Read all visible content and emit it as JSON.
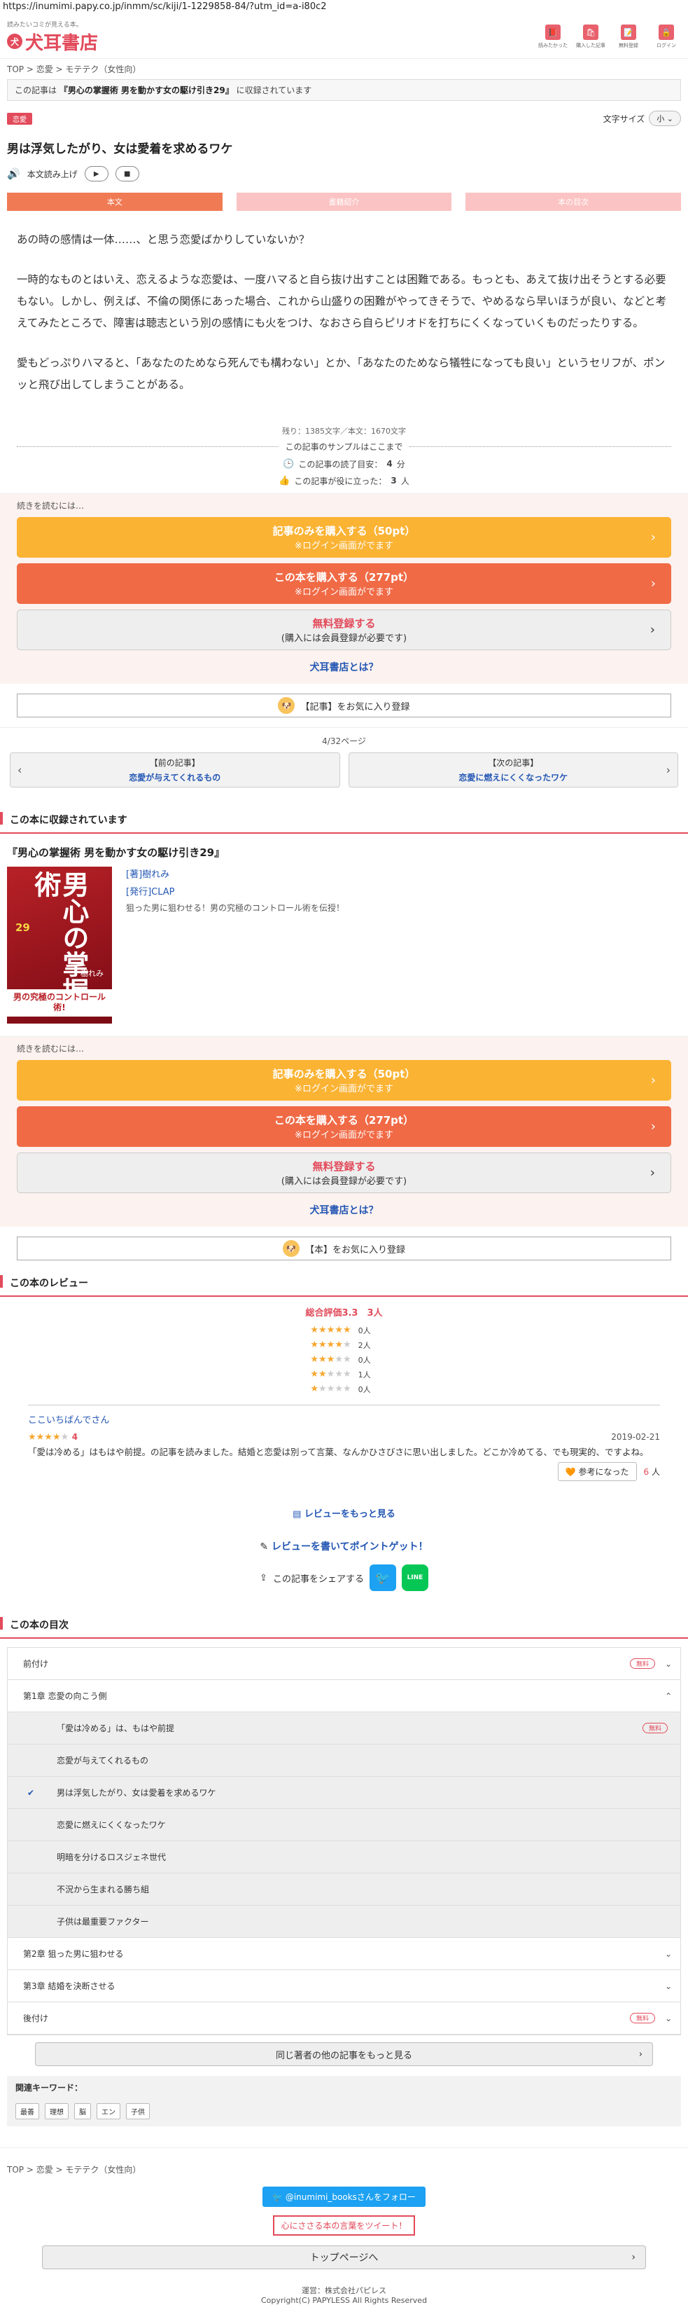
{
  "url": "https://inumimi.papy.co.jp/inmm/sc/kiji/1-1229858-84/?utm_id=a-i80c2",
  "header": {
    "tagline": "読みたいコミが見える本。",
    "logo_text": "犬耳書店",
    "icons": [
      {
        "label": "読みたかった",
        "name": "bookmark-icon",
        "glyph": "📕"
      },
      {
        "label": "購入した記事",
        "name": "purchased-icon",
        "glyph": "🛍"
      },
      {
        "label": "無料登録",
        "name": "register-icon",
        "glyph": "📝"
      },
      {
        "label": "ログイン",
        "name": "login-icon",
        "glyph": "🔒"
      }
    ]
  },
  "breadcrumb": [
    "TOP",
    "恋愛",
    "モテテク（女性向）"
  ],
  "collected_note": {
    "prefix": "この記事は",
    "book": "『男心の掌握術 男を動かす女の駆け引き29』",
    "suffix": "に収録されています"
  },
  "category_badge": "恋愛",
  "font_size": {
    "label": "文字サイズ",
    "value": "小"
  },
  "title": "男は浮気したがり、女は愛着を求めるワケ",
  "tts": {
    "label": "本文読み上げ",
    "play": "▶",
    "stop": "■"
  },
  "tabs": [
    {
      "label": "本文",
      "active": true
    },
    {
      "label": "書籍紹介",
      "active": false
    },
    {
      "label": "本の目次",
      "active": false
    }
  ],
  "article": {
    "paragraphs": [
      "あの時の感情は一体……、と思う恋愛ばかりしていないか？",
      "一時的なものとはいえ、恋えるような恋愛は、一度ハマると自ら抜け出すことは困難である。もっとも、あえて抜け出そうとする必要もない。しかし、例えば、不倫の関係にあった場合、これから山盛りの困難がやってきそうで、やめるなら早いほうが良い、などと考えてみたところで、障害は聴志という別の感情にも火をつけ、なおさら自らピリオドを打ちにくくなっていくものだったりする。",
      "愛もどっぷりハマると、「あなたのためなら死んでも構わない」とか、「あなたのためなら犠牲になっても良い」というセリフが、ポンッと飛び出してしまうことがある。"
    ],
    "counts": "残り：1385文字／本文：1670文字",
    "sample_end": "この記事のサンプルはここまで",
    "read_time_prefix": "この記事の読了目安：",
    "read_time": "4",
    "read_time_unit": "分",
    "helpful_prefix": "この記事が役に立った：",
    "helpful": "3",
    "helpful_unit": "人"
  },
  "buy_box": {
    "lead": "続きを読むには…",
    "article_buy": {
      "l1": "記事のみを購入する（50pt）",
      "l2": "※ログイン画面がでます"
    },
    "book_buy": {
      "l1": "この本を購入する（277pt）",
      "l2": "※ログイン画面がでます"
    },
    "register": {
      "l1": "無料登録する",
      "l2": "(購入には会員登録が必要です)"
    },
    "whatis": "犬耳書店とは？",
    "arrow": "›"
  },
  "fav_article": "【記事】をお気に入り登録",
  "page_num": "4/32ページ",
  "prev": {
    "label": "【前の記事】",
    "title": "恋愛が与えてくれるもの",
    "arrow": "‹"
  },
  "next": {
    "label": "【次の記事】",
    "title": "恋愛に燃えにくくなったワケ",
    "arrow": "›"
  },
  "section_book": "この本に収録されています",
  "book": {
    "title": "『男心の掌握術 男を動かす女の駆け引き29』",
    "author": "[著]樹れみ",
    "publisher": "[発行]CLAP",
    "desc": "狙った男に狙わせる！男の究極のコントロール術を伝授！",
    "cover_big": "男心の掌握術",
    "cover_num": "29",
    "cover_author": "樹れみ",
    "cover_band": "男の究極のコントロール術!"
  },
  "fav_book": "【本】をお気に入り登録",
  "section_review": "この本のレビュー",
  "reviews": {
    "avg_label": "総合評価3.3　3人",
    "dist": [
      {
        "stars": 5,
        "count": "0人"
      },
      {
        "stars": 4,
        "count": "2人"
      },
      {
        "stars": 3,
        "count": "0人"
      },
      {
        "stars": 2,
        "count": "1人"
      },
      {
        "stars": 1,
        "count": "0人"
      }
    ],
    "item": {
      "reviewer": "ここいちばんでさん",
      "score": "4",
      "date": "2019-02-21",
      "text": "「愛は冷める」はもはや前提。の記事を読みました。結婚と恋愛は別って言葉、なんかひさびさに思い出しました。どこか冷めてる、でも現実的、ですよね。",
      "helpful_label": "参考になった",
      "helpful_count": "6",
      "helpful_unit": "人"
    },
    "more": "レビューをもっと見る",
    "write": "レビューを書いてポイントゲット！"
  },
  "share_label": "この記事をシェアする",
  "section_toc": "この本の目次",
  "toc": [
    {
      "label": "前付け",
      "free": true,
      "level": 0,
      "chev": "⌄"
    },
    {
      "label": "第1章 恋愛の向こう側",
      "free": false,
      "level": 0,
      "chev": "⌃"
    },
    {
      "label": "「愛は冷める」は、もはや前提",
      "free": true,
      "level": 1,
      "current": false
    },
    {
      "label": "恋愛が与えてくれるもの",
      "free": false,
      "level": 1,
      "current": false
    },
    {
      "label": "男は浮気したがり、女は愛着を求めるワケ",
      "free": false,
      "level": 1,
      "current": true
    },
    {
      "label": "恋愛に燃えにくくなったワケ",
      "free": false,
      "level": 1,
      "current": false
    },
    {
      "label": "明暗を分けるロスジェネ世代",
      "free": false,
      "level": 1,
      "current": false
    },
    {
      "label": "不況から生まれる勝ち組",
      "free": false,
      "level": 1,
      "current": false
    },
    {
      "label": "子供は最重要ファクター",
      "free": false,
      "level": 1,
      "current": false
    },
    {
      "label": "第2章 狙った男に狙わせる",
      "free": false,
      "level": 0,
      "chev": "⌄"
    },
    {
      "label": "第3章 結婚を決断させる",
      "free": false,
      "level": 0,
      "chev": "⌄"
    },
    {
      "label": "後付け",
      "free": true,
      "level": 0,
      "chev": "⌄"
    }
  ],
  "free_label": "無料",
  "more_author": "同じ著者の他の記事をもっと見る",
  "keywords": {
    "title": "関連キーワード：",
    "items": [
      "最善",
      "理想",
      "脳",
      "エン",
      "子供"
    ]
  },
  "follow": "@inumimi_booksさんをフォロー",
  "tweet_book": "心にささる本の言葉をツイート！",
  "toppage": "トップページへ",
  "footer": {
    "line1": "運営：株式会社パピレス",
    "line2": "Copyright(C) PAPYLESS All Rights Reserved"
  }
}
